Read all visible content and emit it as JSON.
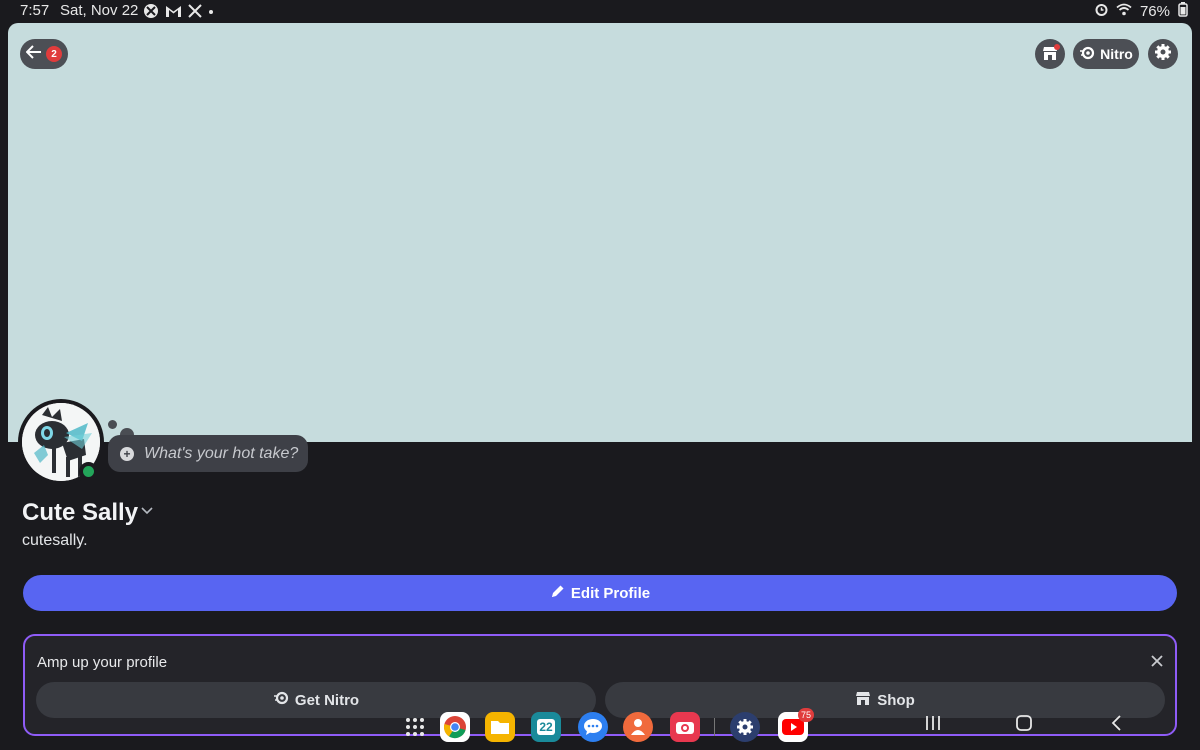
{
  "status_bar": {
    "time": "7:57",
    "date": "Sat, Nov 22",
    "notification_icons": [
      "xbox-icon",
      "gmail-icon",
      "x-icon",
      "more-dot-icon"
    ],
    "battery": "76%"
  },
  "banner": {
    "color": "#c6dcdd",
    "back_badge": "2",
    "nitro_label": "Nitro"
  },
  "profile": {
    "hot_take_placeholder": "What's your hot take?",
    "display_name": "Cute Sally",
    "username": "cutesally.",
    "status_color": "#23a55a"
  },
  "actions": {
    "edit_profile_label": "Edit Profile"
  },
  "amp_card": {
    "title": "Amp up your profile",
    "get_nitro_label": "Get Nitro",
    "shop_label": "Shop"
  },
  "dock": {
    "apps": [
      "chrome",
      "files",
      "calendar",
      "messages",
      "contacts",
      "camera",
      "settings",
      "youtube"
    ],
    "calendar_day": "22",
    "youtube_badge": "75"
  },
  "colors": {
    "accent": "#5865f2",
    "card_border": "#8f5cf7",
    "background": "#1a1a1e"
  }
}
